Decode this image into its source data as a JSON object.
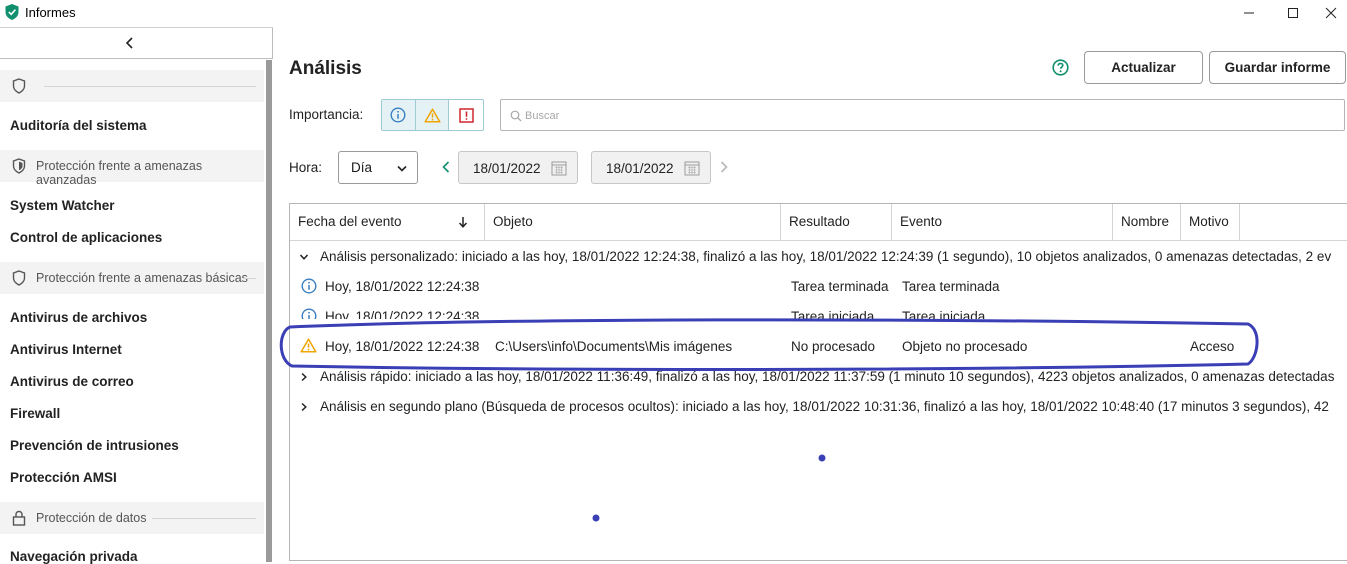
{
  "window": {
    "title": "Informes"
  },
  "sidebar": {
    "sections": [
      {
        "label": "",
        "items": [
          "Auditoría del sistema"
        ]
      },
      {
        "label": "Protección frente a amenazas avanzadas",
        "items": [
          "System Watcher",
          "Control de aplicaciones"
        ]
      },
      {
        "label": "Protección frente a amenazas básicas",
        "items": [
          "Antivirus de archivos",
          "Antivirus Internet",
          "Antivirus de correo",
          "Firewall",
          "Prevención de intrusiones",
          "Protección AMSI"
        ]
      },
      {
        "label": "Protección de datos",
        "items": [
          "Navegación privada"
        ]
      }
    ]
  },
  "main": {
    "title": "Análisis",
    "help_icon": "question-circle-icon",
    "buttons": {
      "refresh": "Actualizar",
      "save_report": "Guardar informe"
    },
    "filters": {
      "importance_label": "Importancia:",
      "search_placeholder": "Buscar",
      "time_label": "Hora:",
      "period": "Día",
      "date_from": "18/01/2022",
      "date_to": "18/01/2022"
    },
    "table": {
      "columns": [
        "Fecha del evento",
        "Objeto",
        "Resultado",
        "Evento",
        "Nombre",
        "Motivo"
      ],
      "groups": [
        "Análisis personalizado: iniciado a las hoy, 18/01/2022 12:24:38, finalizó a las hoy, 18/01/2022 12:24:39 (1 segundo), 10 objetos analizados, 0 amenazas detectadas, 2 ev",
        "Análisis rápido: iniciado a las hoy, 18/01/2022 11:36:49, finalizó a las hoy, 18/01/2022 11:37:59 (1 minuto 10 segundos), 4223 objetos analizados, 0 amenazas detectadas",
        "Análisis en segundo plano (Búsqueda de procesos ocultos): iniciado a las hoy, 18/01/2022 10:31:36, finalizó a las hoy, 18/01/2022 10:48:40 (17 minutos 3 segundos), 42"
      ],
      "rows": [
        {
          "date": "Hoy, 18/01/2022 12:24:38",
          "object": "",
          "result": "Tarea terminada",
          "event": "Tarea terminada",
          "name": "",
          "reason": ""
        },
        {
          "date": "Hoy, 18/01/2022 12:24:38",
          "object": "",
          "result": "Tarea iniciada",
          "event": "Tarea iniciada",
          "name": "",
          "reason": ""
        },
        {
          "date": "Hoy, 18/01/2022 12:24:38",
          "object": "C:\\Users\\info\\Documents\\Mis imágenes",
          "result": "No procesado",
          "event": "Objeto no procesado",
          "name": "",
          "reason": "Acceso"
        }
      ]
    }
  },
  "colors": {
    "accent": "#0f8f6e",
    "info": "#3a7fc1",
    "warning": "#f0a500",
    "danger": "#d0262f",
    "annotation": "#3a3fb5"
  }
}
